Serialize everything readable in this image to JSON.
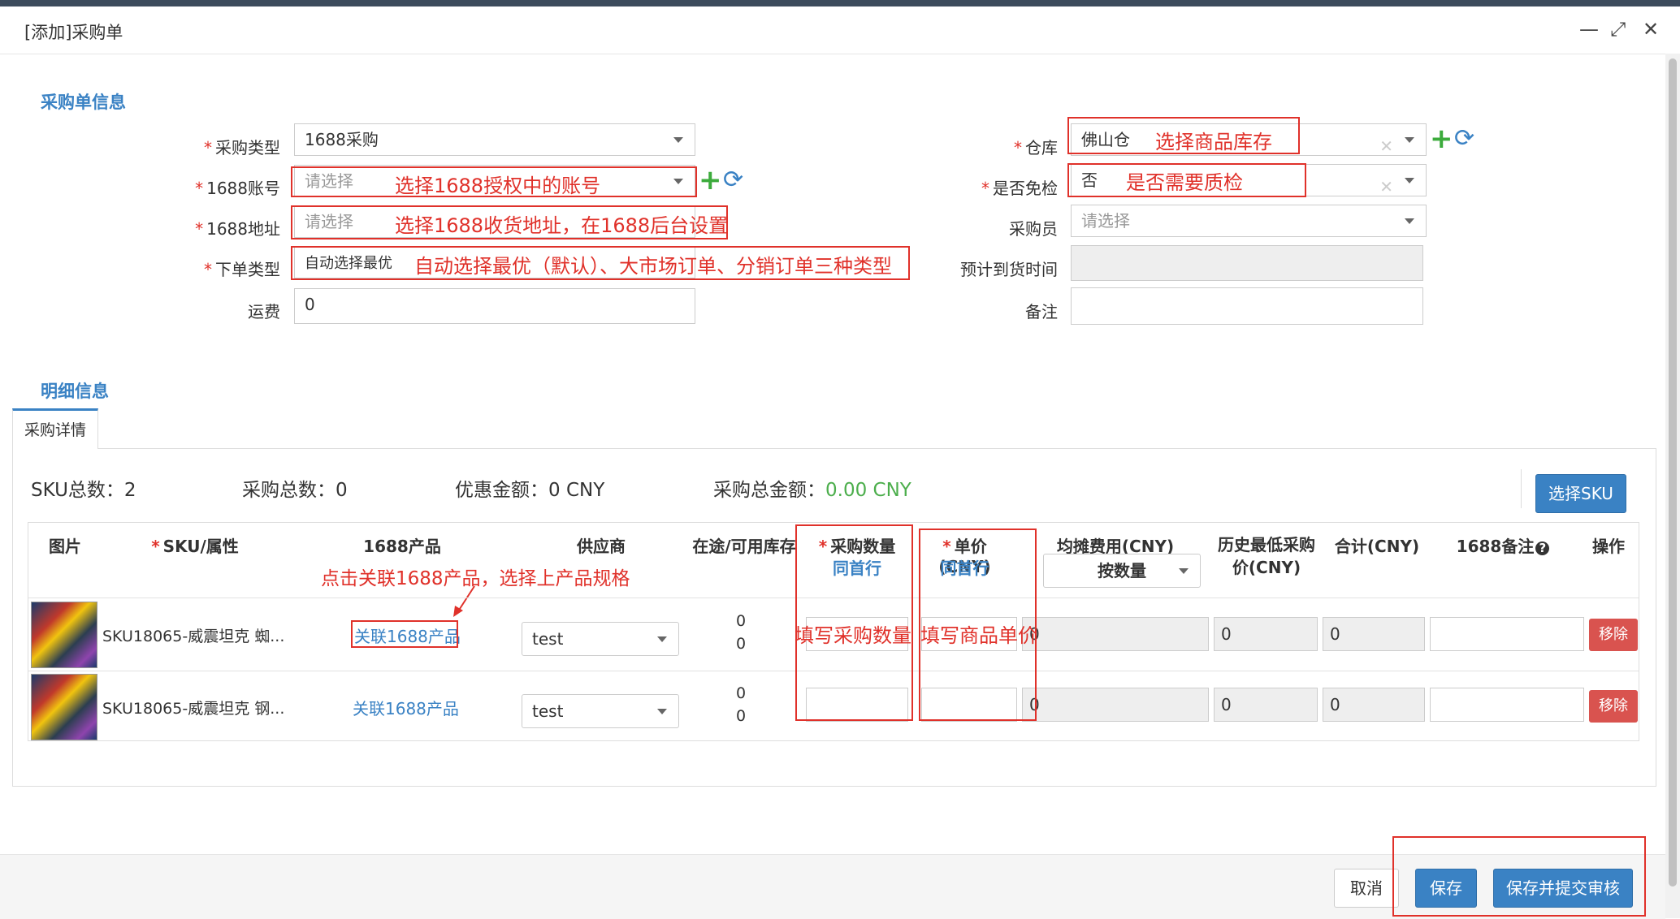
{
  "window": {
    "title": "[添加]采购单",
    "minimize": "—",
    "maximize": "⤢",
    "close": "✕"
  },
  "header_section": {
    "title": "采购单信息"
  },
  "form": {
    "purchase_type": {
      "label": "采购类型",
      "value": "1688采购"
    },
    "account_1688": {
      "label": "1688账号",
      "placeholder": "请选择",
      "annotation": "选择1688授权中的账号"
    },
    "address_1688": {
      "label": "1688地址",
      "placeholder": "请选择",
      "annotation": "选择1688收货地址，在1688后台设置"
    },
    "order_type": {
      "label": "下单类型",
      "value": "自动选择最优",
      "annotation": "自动选择最优（默认）、大市场订单、分销订单三种类型"
    },
    "freight": {
      "label": "运费",
      "value": "0"
    },
    "warehouse": {
      "label": "仓库",
      "value": "佛山仓",
      "annotation": "选择商品库存"
    },
    "inspection_free": {
      "label": "是否免检",
      "value": "否",
      "annotation": "是否需要质检"
    },
    "buyer": {
      "label": "采购员",
      "placeholder": "请选择"
    },
    "eta": {
      "label": "预计到货时间",
      "value": ""
    },
    "remark": {
      "label": "备注",
      "value": ""
    }
  },
  "detail_section": {
    "title": "明细信息",
    "tab": "采购详情"
  },
  "summary": {
    "sku_total": "SKU总数：2",
    "purchase_total": "采购总数：0",
    "discount_label": "优惠金额：0 CNY",
    "amount_label": "采购总金额：",
    "amount_value": "0.00 CNY",
    "select_sku": "选择SKU"
  },
  "table": {
    "headers": {
      "image": "图片",
      "sku": "SKU/属性",
      "product_1688": "1688产品",
      "supplier": "供应商",
      "stock": "在途/可用库存",
      "qty": "采购数量",
      "qty_sub": "同首行",
      "price": "单价(CNY)",
      "price_sub": "同首行",
      "alloc": "均摊费用(CNY)",
      "alloc_select": "按数量",
      "hist_low": "历史最低采购价(CNY)",
      "total": "合计(CNY)",
      "remark_1688": "1688备注",
      "action": "操作"
    },
    "annotation_link": "点击关联1688产品，选择上产品规格",
    "annotation_qty": "填写采购数量",
    "annotation_price": "填写商品单价",
    "rows": [
      {
        "sku": "SKU18065-威震坦克 蜘...",
        "link": "关联1688产品",
        "supplier": "test",
        "in_transit": "0",
        "available": "0",
        "alloc": "0",
        "hist": "0",
        "total": "0",
        "action": "移除"
      },
      {
        "sku": "SKU18065-威震坦克 钢...",
        "link": "关联1688产品",
        "supplier": "test",
        "in_transit": "0",
        "available": "0",
        "alloc": "0",
        "hist": "0",
        "total": "0",
        "action": "移除"
      }
    ]
  },
  "footer": {
    "cancel": "取消",
    "save": "保存",
    "save_submit": "保存并提交审核"
  }
}
